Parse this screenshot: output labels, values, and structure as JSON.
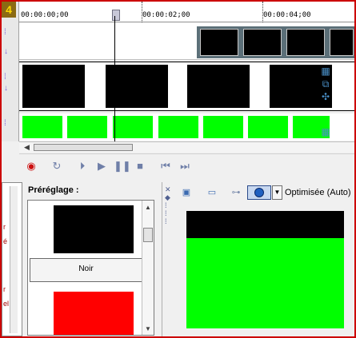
{
  "timeline": {
    "ruler_labels": [
      "00:00:00;00",
      "00:00:02;00",
      "00:00:04;00"
    ]
  },
  "corner_badge": "4",
  "track_icons": [
    "film-strip-icon",
    "crop-icon",
    "pan-icon",
    "film-strip-icon"
  ],
  "transport": [
    "record-icon",
    "loop-icon",
    "play-from-start-icon",
    "play-icon",
    "pause-icon",
    "stop-icon",
    "previous-frame-icon",
    "next-frame-icon"
  ],
  "preset_pane": {
    "title": "Préréglage :",
    "items": [
      {
        "name": "Noir",
        "color": "#000000"
      },
      {
        "name": "",
        "color": "#ff0000"
      }
    ]
  },
  "preview": {
    "quality_label": "Optimisée (Auto)",
    "frame_top_color": "#000000",
    "frame_color": "#00ff00"
  },
  "colors": {
    "accent": "#cc0000",
    "green": "#00ff00",
    "overlay_strip": "#5b6f78"
  }
}
